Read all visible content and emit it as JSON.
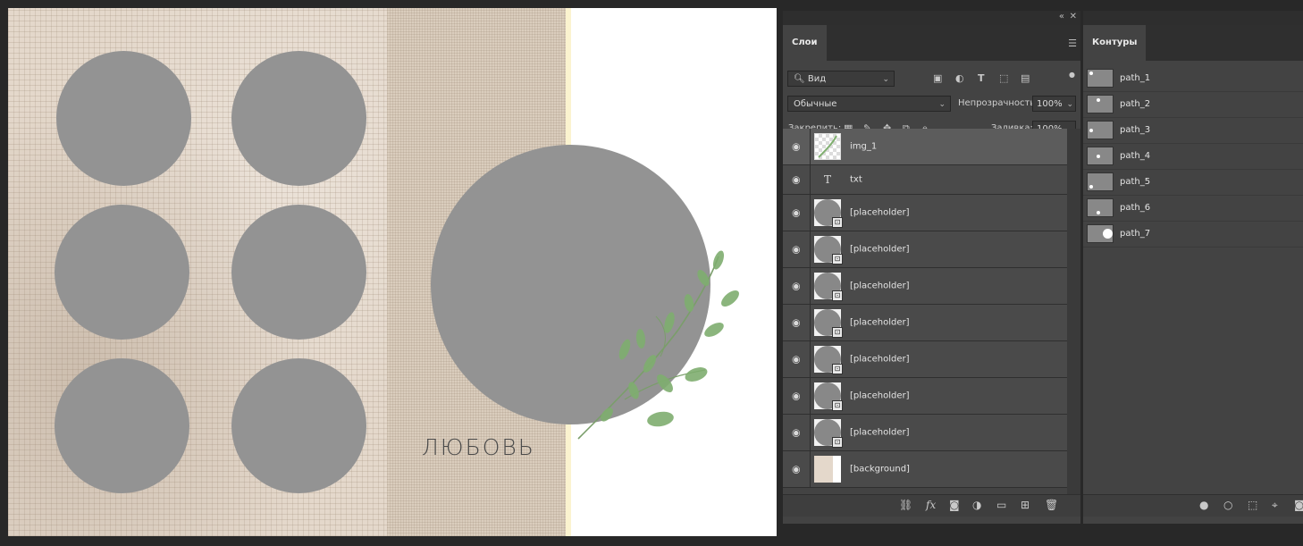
{
  "canvas": {
    "word": "ЛЮБОВЬ",
    "placeholders": 7
  },
  "layers_panel": {
    "tab": "Слои",
    "search": {
      "label": "Вид"
    },
    "blend_mode": "Обычные",
    "opacity_label": "Непрозрачность:",
    "opacity_value": "100%",
    "lock_label": "Закрепить:",
    "fill_label": "Заливка:",
    "fill_value": "100%",
    "layers": [
      {
        "name": "img_1",
        "type": "image",
        "selected": true
      },
      {
        "name": "txt",
        "type": "text"
      },
      {
        "name": "[placeholder]",
        "type": "smart"
      },
      {
        "name": "[placeholder]",
        "type": "smart"
      },
      {
        "name": "[placeholder]",
        "type": "smart"
      },
      {
        "name": "[placeholder]",
        "type": "smart"
      },
      {
        "name": "[placeholder]",
        "type": "smart"
      },
      {
        "name": "[placeholder]",
        "type": "smart"
      },
      {
        "name": "[placeholder]",
        "type": "smart"
      },
      {
        "name": "[background]",
        "type": "background"
      }
    ]
  },
  "paths_panel": {
    "tab": "Контуры",
    "paths": [
      "path_1",
      "path_2",
      "path_3",
      "path_4",
      "path_5",
      "path_6",
      "path_7"
    ]
  },
  "colors": {
    "placeholder": "#939393",
    "panel": "#434343",
    "selected_layer": "#5c5c5c"
  }
}
